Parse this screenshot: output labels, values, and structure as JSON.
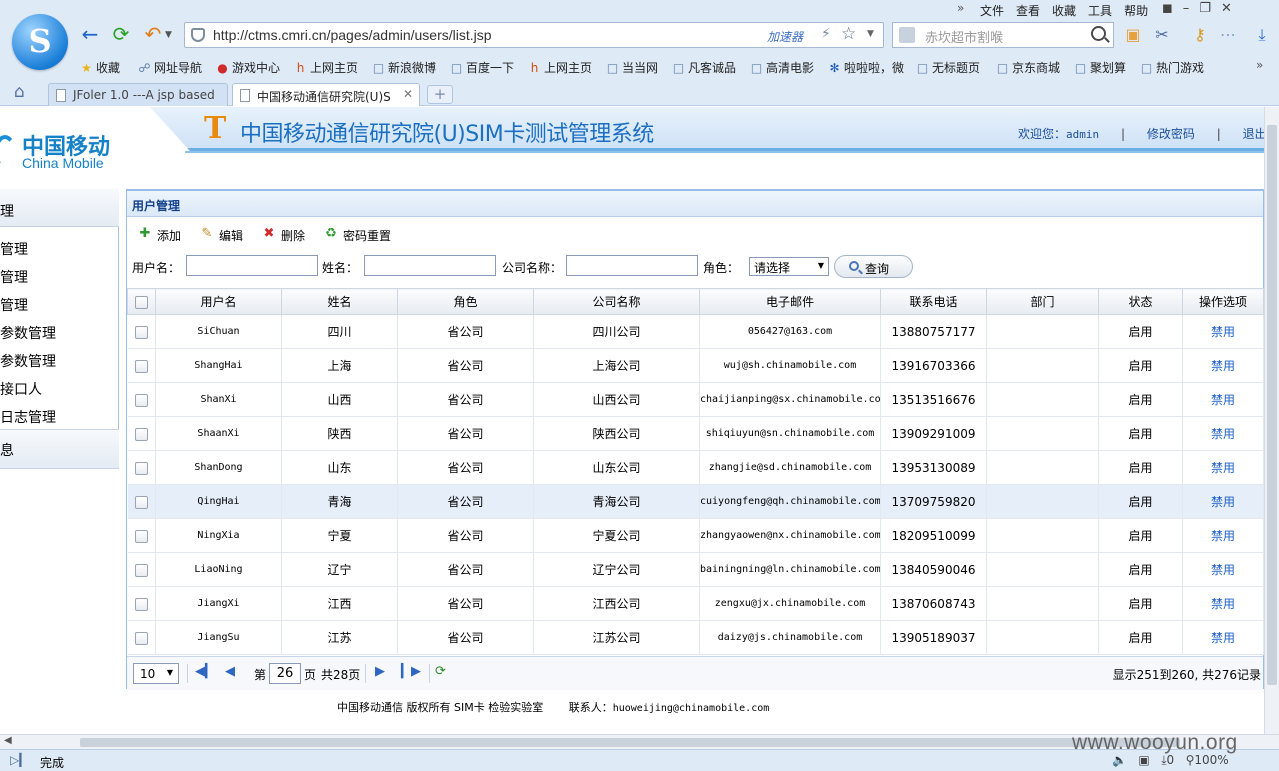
{
  "browser": {
    "menu": [
      "文件",
      "查看",
      "收藏",
      "工具",
      "帮助"
    ],
    "url": "http://ctms.cmri.cn/pages/admin/users/list.jsp",
    "accelerator_label": "加速器",
    "search_placeholder": "赤坎超市割喉",
    "favorites": [
      "收藏",
      "网址导航",
      "游戏中心",
      "上网主页",
      "新浪微博",
      "百度一下",
      "上网主页",
      "当当网",
      "凡客诚品",
      "高清电影",
      "啦啦啦，微",
      "无标题页",
      "京东商城",
      "聚划算",
      "热门游戏"
    ],
    "tabs": [
      {
        "label": "JFoler 1.0 ---A jsp based"
      },
      {
        "label": "中国移动通信研究院(U)S"
      }
    ],
    "status": "完成",
    "zoom": "100%",
    "download_count": "0"
  },
  "header": {
    "logo_cn": "中国移动",
    "logo_en": "China Mobile",
    "system_title": "中国移动通信研究院(U)SIM卡测试管理系统",
    "welcome_label": "欢迎您：",
    "username": "admin",
    "change_password": "修改密码",
    "logout": "退出"
  },
  "sidebar": {
    "head": "理",
    "items": [
      "管理",
      "管理",
      "管理",
      "参数管理",
      "参数管理",
      "接口人",
      "日志管理"
    ],
    "footer": "息"
  },
  "panel": {
    "title": "用户管理",
    "toolbar": {
      "add": "添加",
      "edit": "编辑",
      "delete": "删除",
      "reset_password": "密码重置"
    },
    "search": {
      "username_label": "用户名：",
      "name_label": "姓名：",
      "company_label": "公司名称：",
      "role_label": "角色：",
      "role_value": "请选择",
      "query_button": "查询"
    },
    "columns": [
      "用户名",
      "姓名",
      "角色",
      "公司名称",
      "电子邮件",
      "联系电话",
      "部门",
      "状态",
      "操作选项"
    ],
    "rows": [
      {
        "username": "SiChuan",
        "name": "四川",
        "role": "省公司",
        "company": "四川公司",
        "email": "056427@163.com",
        "phone": "13880757177",
        "dept": "",
        "status": "启用",
        "action": "禁用"
      },
      {
        "username": "ShangHai",
        "name": "上海",
        "role": "省公司",
        "company": "上海公司",
        "email": "wuj@sh.chinamobile.com",
        "phone": "13916703366",
        "dept": "",
        "status": "启用",
        "action": "禁用"
      },
      {
        "username": "ShanXi",
        "name": "山西",
        "role": "省公司",
        "company": "山西公司",
        "email": "chaijianping@sx.chinamobile.co",
        "phone": "13513516676",
        "dept": "",
        "status": "启用",
        "action": "禁用"
      },
      {
        "username": "ShaanXi",
        "name": "陕西",
        "role": "省公司",
        "company": "陕西公司",
        "email": "shiqiuyun@sn.chinamobile.com",
        "phone": "13909291009",
        "dept": "",
        "status": "启用",
        "action": "禁用"
      },
      {
        "username": "ShanDong",
        "name": "山东",
        "role": "省公司",
        "company": "山东公司",
        "email": "zhangjie@sd.chinamobile.com",
        "phone": "13953130089",
        "dept": "",
        "status": "启用",
        "action": "禁用"
      },
      {
        "username": "QingHai",
        "name": "青海",
        "role": "省公司",
        "company": "青海公司",
        "email": "cuiyongfeng@qh.chinamobile.com",
        "phone": "13709759820",
        "dept": "",
        "status": "启用",
        "action": "禁用"
      },
      {
        "username": "NingXia",
        "name": "宁夏",
        "role": "省公司",
        "company": "宁夏公司",
        "email": "zhangyaowen@nx.chinamobile.com",
        "phone": "18209510099",
        "dept": "",
        "status": "启用",
        "action": "禁用"
      },
      {
        "username": "LiaoNing",
        "name": "辽宁",
        "role": "省公司",
        "company": "辽宁公司",
        "email": "bainingning@ln.chinamobile.com",
        "phone": "13840590046",
        "dept": "",
        "status": "启用",
        "action": "禁用"
      },
      {
        "username": "JiangXi",
        "name": "江西",
        "role": "省公司",
        "company": "江西公司",
        "email": "zengxu@jx.chinamobile.com",
        "phone": "13870608743",
        "dept": "",
        "status": "启用",
        "action": "禁用"
      },
      {
        "username": "JiangSu",
        "name": "江苏",
        "role": "省公司",
        "company": "江苏公司",
        "email": "daizy@js.chinamobile.com",
        "phone": "13905189037",
        "dept": "",
        "status": "启用",
        "action": "禁用"
      }
    ],
    "selected_row_index": 5,
    "pager": {
      "page_size": "10",
      "page_prefix": "第",
      "current_page": "26",
      "page_suffix": "页",
      "total_pages": "共28页",
      "range_info": "显示251到260, 共276记录"
    }
  },
  "footer": {
    "copyright": "中国移动通信 版权所有 SIM卡 检验实验室",
    "contact_label": "联系人：",
    "contact_email": "huoweijing@chinamobile.com"
  },
  "watermark": "www.wooyun.org",
  "colors": {
    "brand_blue": "#1582c8",
    "title_blue": "#1b6fc2",
    "link_blue": "#1d60c8",
    "panel_border": "#99bce8"
  }
}
